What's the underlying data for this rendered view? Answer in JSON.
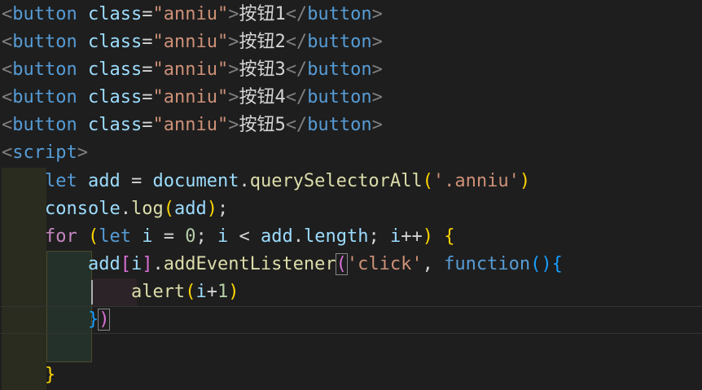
{
  "editor": {
    "theme_colors": {
      "background": "#1e1e1e",
      "tag_bracket": "#808080",
      "tag_name": "#569cd6",
      "attribute": "#9cdcfe",
      "string": "#ce9178",
      "keyword": "#569cd6",
      "control_keyword": "#c586c0",
      "function": "#dcdcaa",
      "number": "#b5cea8"
    },
    "html_lines": [
      {
        "tag": "button",
        "attr": "class",
        "value": "\"anniu\"",
        "text": "按钮1"
      },
      {
        "tag": "button",
        "attr": "class",
        "value": "\"anniu\"",
        "text": "按钮2"
      },
      {
        "tag": "button",
        "attr": "class",
        "value": "\"anniu\"",
        "text": "按钮3"
      },
      {
        "tag": "button",
        "attr": "class",
        "value": "\"anniu\"",
        "text": "按钮4"
      },
      {
        "tag": "button",
        "attr": "class",
        "value": "\"anniu\"",
        "text": "按钮5"
      }
    ],
    "script_tag": "script",
    "js": {
      "kw_let": "let",
      "var_add": "add",
      "document": "document",
      "qsa": "querySelectorAll",
      "selector": "'.anniu'",
      "console": "console",
      "log": "log",
      "kw_for": "for",
      "var_i": "i",
      "zero": "0",
      "length": "length",
      "ael": "addEventListener",
      "click": "'click'",
      "kw_function": "function",
      "alert": "alert",
      "one": "1"
    }
  }
}
